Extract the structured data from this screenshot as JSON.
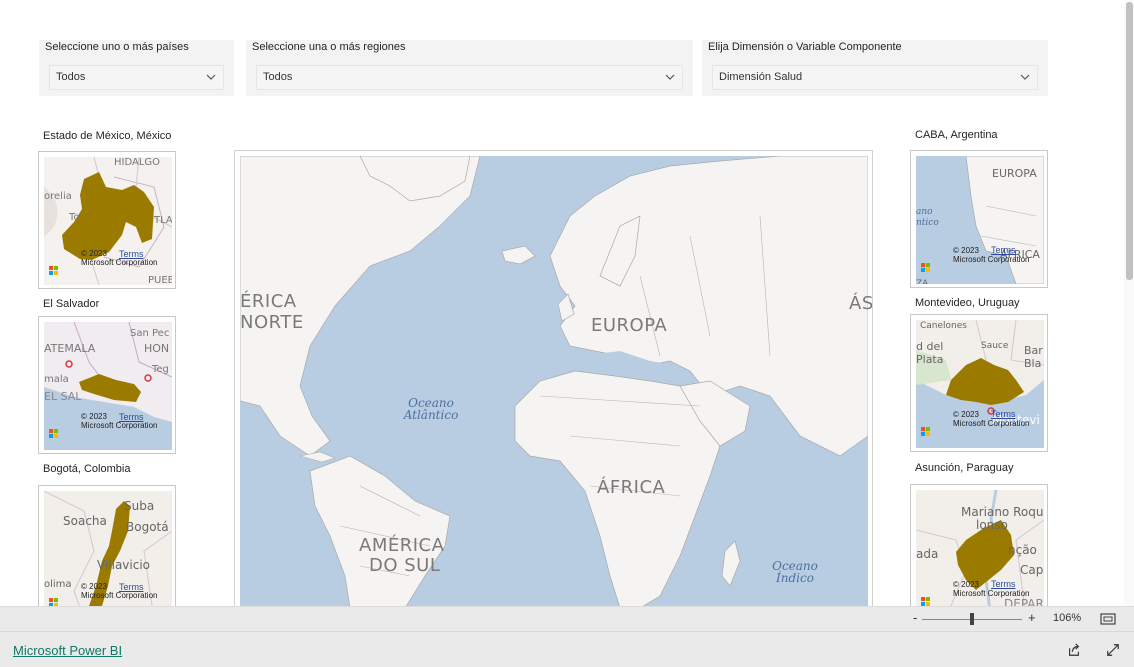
{
  "filters": [
    {
      "label": "Seleccione uno o más países",
      "value": "Todos"
    },
    {
      "label": "Seleccione una o más regiones",
      "value": "Todos"
    },
    {
      "label": "Elija Dimensión o Variable Componente",
      "value": "Dimensión Salud"
    }
  ],
  "tiles": [
    {
      "label": "Estado de México, México",
      "places": [
        "HIDALGO",
        "orelia",
        "To",
        "TLA",
        "PUEB"
      ]
    },
    {
      "label": "El Salvador",
      "places": [
        "San Pec",
        "ATEMALA",
        "HON",
        "Teg",
        "mala",
        "EL SAL"
      ]
    },
    {
      "label": "Bogotá, Colombia",
      "places": [
        "Suba",
        "Soacha",
        "Bogotá",
        "Villavicio",
        "olima"
      ]
    },
    {
      "label": "CABA, Argentina",
      "places": [
        "EUROPA",
        "ano",
        "ntico",
        "ÁFRICA",
        "ZA"
      ]
    },
    {
      "label": "Montevideo, Uruguay",
      "places": [
        "Canelones",
        "d del",
        "Plata",
        "Sauce",
        "Bar",
        "Bla",
        "Montevi"
      ]
    },
    {
      "label": "Asunción, Paraguay",
      "places": [
        "Mariano Roque",
        "lonso",
        "ada",
        "nção",
        "Capi",
        "DEPAR"
      ]
    }
  ],
  "map_attribution": {
    "copyright": "© 2023",
    "company": "Microsoft Corporation",
    "terms": "Terms"
  },
  "main_map": {
    "labels": {
      "europe": "EUROPA",
      "africa": "ÁFRICA",
      "south_america_1": "AMÉRICA",
      "south_america_2": "DO SUL",
      "north_america_1": "ÉRICA",
      "north_america_2": "NORTE",
      "asia": "ÁS"
    },
    "oceans": {
      "atlantic_1": "Oceano",
      "atlantic_2": "Atlântico",
      "indian_1": "Oceano",
      "indian_2": "Índico"
    }
  },
  "zoom": {
    "minus": "-",
    "plus": "+",
    "value": "106%"
  },
  "footer": {
    "brand": "Microsoft Power BI"
  },
  "colors": {
    "region_fill": "#9b7a00",
    "water": "#b8cde2",
    "land": "#f6f4f2",
    "border": "#a9a9a9"
  }
}
